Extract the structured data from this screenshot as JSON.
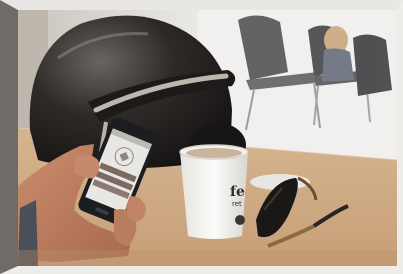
{
  "photo": {
    "cup_print": "fe",
    "cup_print_2": "ret",
    "cup_logo": "e"
  }
}
